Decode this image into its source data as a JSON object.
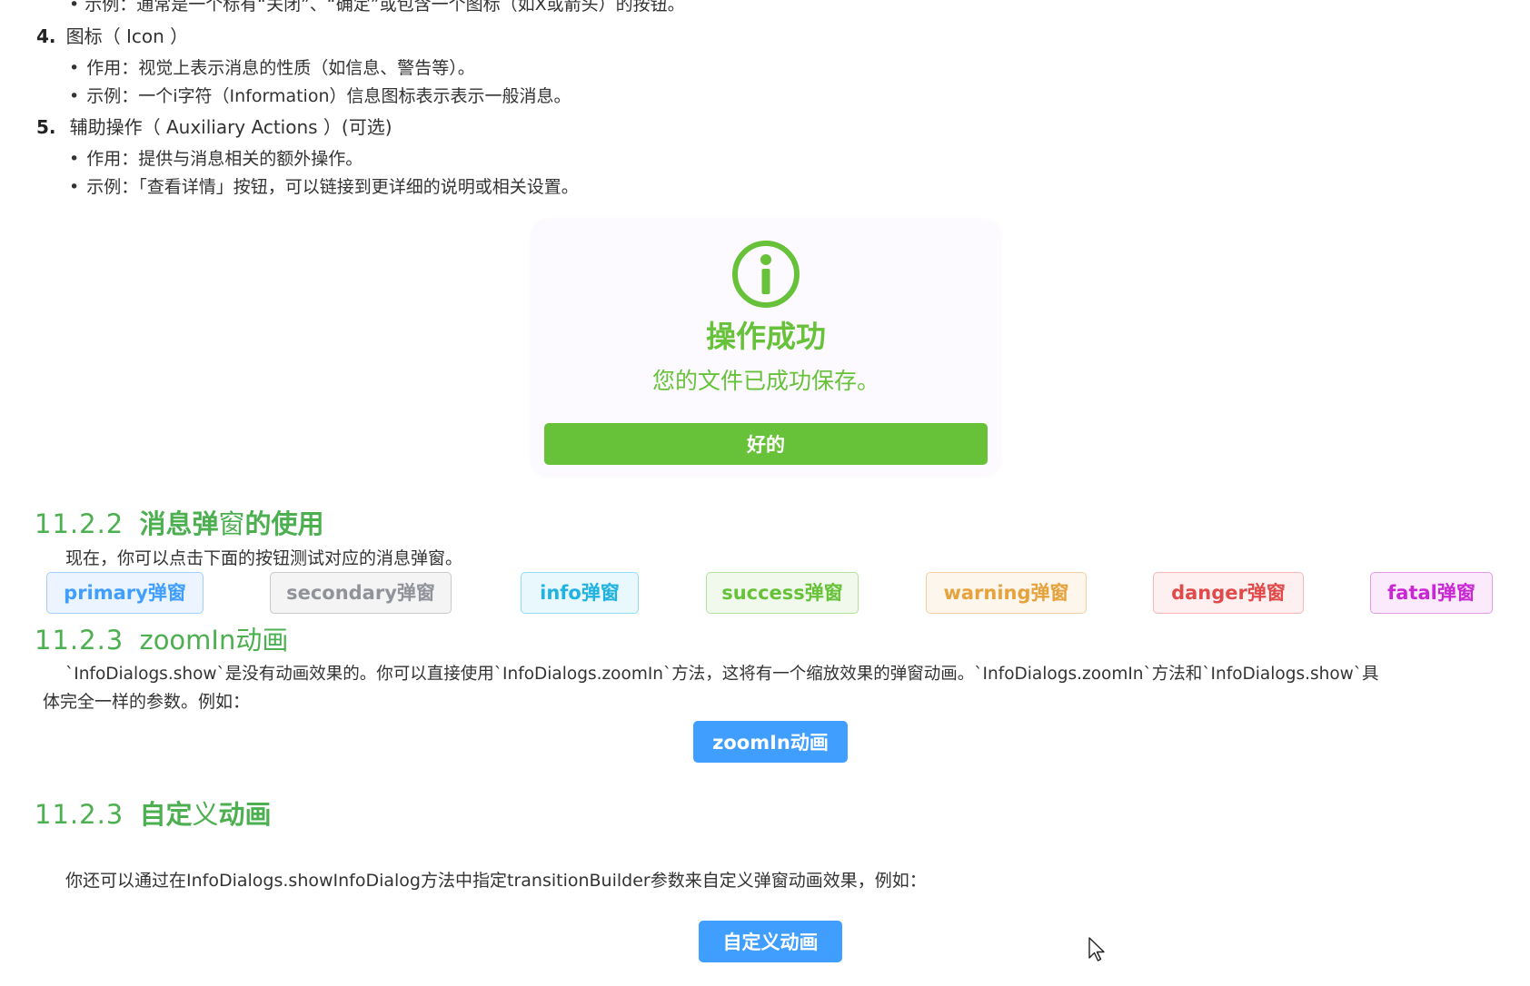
{
  "doc": {
    "top_clip": "• 示例：通常是一个标有“关闭”、“确定”或包含一个图标（如X或箭头）的按钮。",
    "item4": {
      "num": "4.",
      "title": "图标（ Icon ）",
      "bullets": [
        "作用：视觉上表示消息的性质（如信息、警告等）。",
        "示例：一个i字符（Information）信息图标表示表示一般消息。"
      ]
    },
    "item5": {
      "num": "5.",
      "title": "辅助操作（ Auxiliary Actions ）(可选)",
      "bullets": [
        "作用：提供与消息相关的额外操作。",
        "示例：「查看详情」按钮，可以链接到更详细的说明或相关设置。"
      ]
    },
    "section_1122": {
      "num": "11.2.2",
      "title_bold": "消息弹",
      "title_mid": "窗",
      "title_rest": "的使用",
      "intro": "现在，你可以点击下面的按钮测试对应的消息弹窗。"
    },
    "section_1123a": {
      "num": "11.2.3",
      "title": "zoomIn动画",
      "para_line1": "`InfoDialogs.show`是没有动画效果的。你可以直接使用`InfoDialogs.zoomIn`方法，这将有一个缩放效果的弹窗动画。`InfoDialogs.zoomIn`方法和`InfoDialogs.show`具",
      "para_line2": "体完全一样的参数。例如：",
      "button": "zoomIn动画"
    },
    "section_1123b": {
      "num": "11.2.3",
      "title_bold": "自定",
      "title_mid": "义",
      "title_rest": "动画",
      "para": "你还可以通过在InfoDialogs.showInfoDialog方法中指定transitionBuilder参数来自定义弹窗动画效果，例如：",
      "button": "自定义动画"
    }
  },
  "dialog": {
    "icon": "info-circle-icon",
    "title": "操作成功",
    "message": "您的文件已成功保存。",
    "ok_button": "好的",
    "color": "#67c23a"
  },
  "buttons": [
    {
      "label": "primary弹窗",
      "bg": "#ecf5ff",
      "border": "#a0cfff",
      "color": "#409eff"
    },
    {
      "label": "secondary弹窗",
      "bg": "#f4f4f5",
      "border": "#c8c9cc",
      "color": "#909399"
    },
    {
      "label": "info弹窗",
      "bg": "#e8f8fd",
      "border": "#8fdcf5",
      "color": "#20b2e0"
    },
    {
      "label": "success弹窗",
      "bg": "#f0f9eb",
      "border": "#b3e19d",
      "color": "#67c23a"
    },
    {
      "label": "warning弹窗",
      "bg": "#fdf6ec",
      "border": "#f3d19e",
      "color": "#e6a23c"
    },
    {
      "label": "danger弹窗",
      "bg": "#fef0f0",
      "border": "#fab6b6",
      "color": "#e04a4a"
    },
    {
      "label": "fatal弹窗",
      "bg": "#fbeafc",
      "border": "#e49ae6",
      "color": "#c927d3"
    }
  ]
}
